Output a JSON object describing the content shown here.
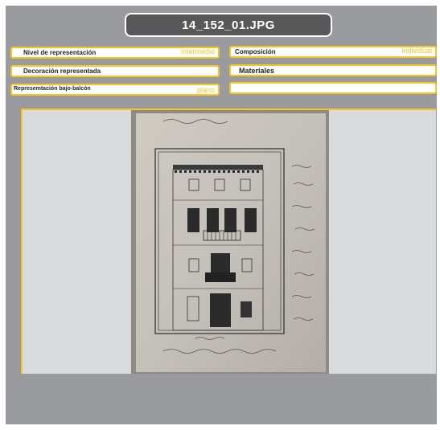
{
  "title": "14_152_01.JPG",
  "fields": {
    "nivel": {
      "label": "Nivel de representación",
      "value": "intermedio"
    },
    "composicion": {
      "label": "Composición",
      "value": "individual"
    },
    "decoracion": {
      "label": "Decoración representada",
      "value": ""
    },
    "materiales": {
      "label": "Materiales",
      "value": ""
    },
    "bajo_balcon": {
      "label": "Represemtación bajo-balcón",
      "value": "plano"
    },
    "empty": {
      "label": "",
      "value": ""
    }
  },
  "colors": {
    "accent": "#f7c51e",
    "panel": "#999b9e",
    "title_bg": "#58585a"
  }
}
